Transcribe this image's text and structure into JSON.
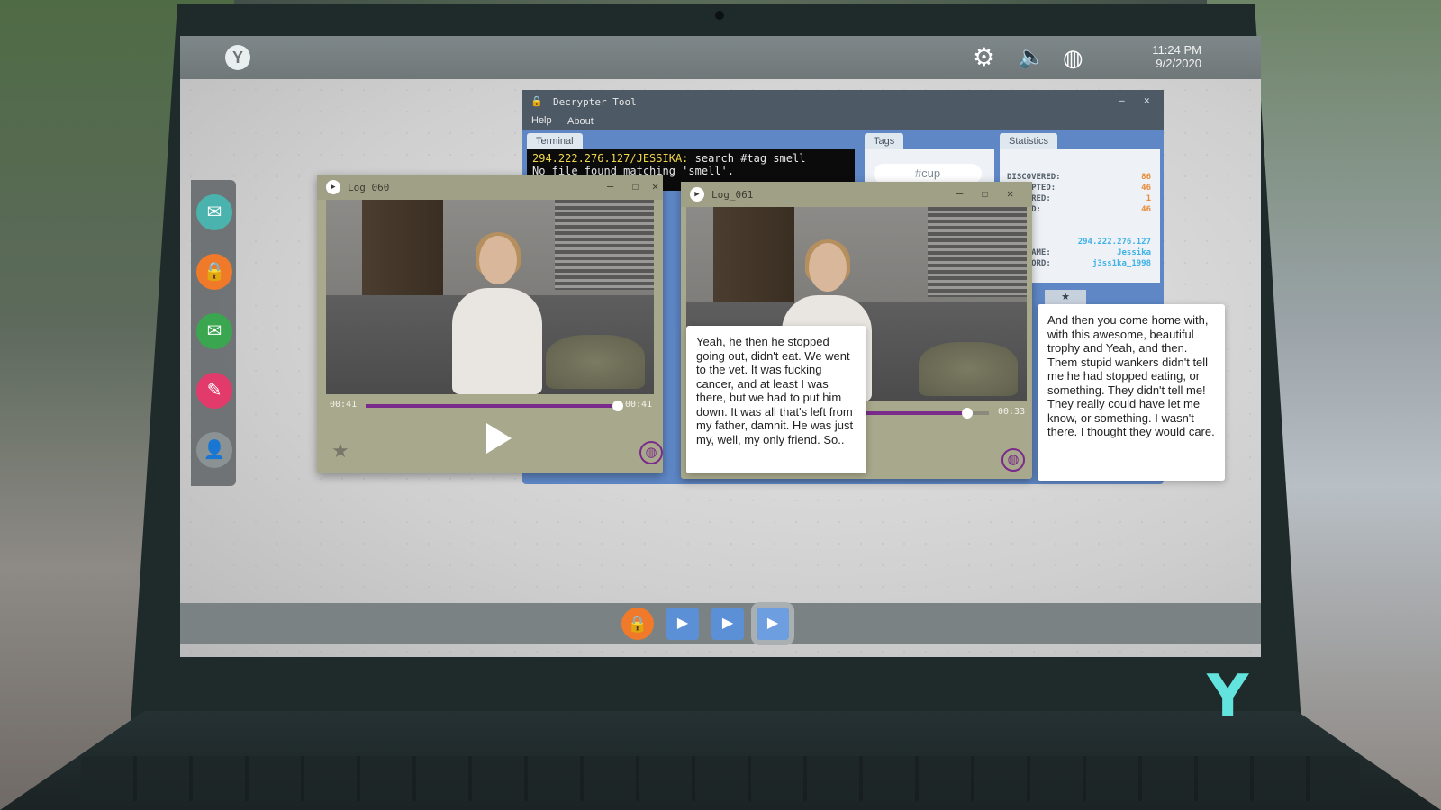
{
  "system": {
    "time": "11:24 PM",
    "date": "9/2/2020",
    "tray_icons": [
      "gear-icon",
      "speaker-icon",
      "globe-icon"
    ]
  },
  "left_dock": {
    "apps": [
      {
        "name": "chat",
        "icon": "chat-icon",
        "color": "#4bb3ad"
      },
      {
        "name": "decrypter",
        "icon": "lock-icon",
        "color": "#f07a2a"
      },
      {
        "name": "mail",
        "icon": "mail-icon",
        "color": "#3aa64f"
      },
      {
        "name": "notes",
        "icon": "notepad-icon",
        "color": "#e23b6b"
      },
      {
        "name": "contacts",
        "icon": "user-icon",
        "color": "#8a9294"
      }
    ]
  },
  "decrypter": {
    "title": "Decrypter Tool",
    "menu": [
      "Help",
      "About"
    ],
    "tabs": {
      "terminal": "Terminal",
      "tags": "Tags",
      "statistics": "Statistics"
    },
    "terminal": {
      "prompt": "294.222.276.127/JESSIKA:",
      "command": "search #tag smell",
      "output": "No file found matching 'smell'."
    },
    "tag_chip": "#cup",
    "stats": [
      {
        "label": "DISCOVERED:",
        "value": "86"
      },
      {
        "label": "DECRYPTED:",
        "value": "46"
      },
      {
        "label": "RESTORED:",
        "value": "1"
      },
      {
        "label": "OPENED:",
        "value": "46"
      }
    ],
    "connection": {
      "ip": "294.222.276.127",
      "username_label": "USERNAME:",
      "username": "Jessika",
      "password_label": "PASSWORD:",
      "password": "j3ss1ka_1998"
    },
    "star_tab": "★"
  },
  "video1": {
    "title": "Log_060",
    "elapsed": "00:41",
    "duration": "00:41",
    "progress": 1.0
  },
  "video2": {
    "title": "Log_061",
    "elapsed": "00:33",
    "progress": 0.93,
    "subtitle_left": "Yeah, he then he stopped going out, didn't eat. We went to the vet. It was fucking cancer, and at least I was there, but we had to put him down. It was all that's left from my father, damnit. He was just my, well, my only friend. So..",
    "subtitle_right": "And then you come home with, with this awesome, beautiful trophy and Yeah, and then. Them stupid wankers didn't tell me he had stopped eating, or something. They didn't tell me! They really could have let me know, or something. I wasn't there. I thought they would care."
  },
  "taskbar": {
    "items": [
      {
        "icon": "lock-icon",
        "active": false
      },
      {
        "icon": "video-file-icon",
        "active": false
      },
      {
        "icon": "video-file-icon",
        "active": false
      },
      {
        "icon": "video-file-icon",
        "active": true
      }
    ]
  },
  "colors": {
    "accent_purple": "#7a2a8a",
    "terminal_prompt": "#f0d64b",
    "stat_value": "#e88b3a",
    "conn_value": "#3fb2e6",
    "brand": "#63e3de"
  }
}
